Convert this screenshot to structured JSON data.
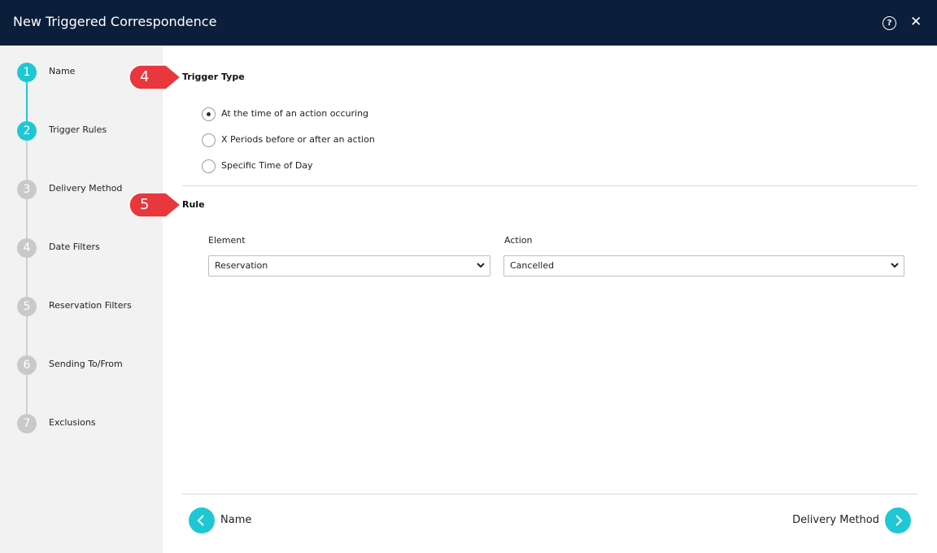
{
  "window": {
    "title": "New Triggered Correspondence",
    "help_icon": "question-circle-icon",
    "close_icon": "close-icon"
  },
  "steps": [
    {
      "num": "1",
      "label": "Name",
      "state": "done"
    },
    {
      "num": "2",
      "label": "Trigger Rules",
      "state": "active"
    },
    {
      "num": "3",
      "label": "Delivery Method",
      "state": "pending"
    },
    {
      "num": "4",
      "label": "Date Filters",
      "state": "pending"
    },
    {
      "num": "5",
      "label": "Reservation Filters",
      "state": "pending"
    },
    {
      "num": "6",
      "label": "Sending To/From",
      "state": "pending"
    },
    {
      "num": "7",
      "label": "Exclusions",
      "state": "pending"
    }
  ],
  "callouts": {
    "trigger": "4",
    "rule": "5"
  },
  "trigger_type": {
    "title": "Trigger Type",
    "options": [
      {
        "label": "At the time of an action occuring",
        "checked": true
      },
      {
        "label": "X Periods before or after an action",
        "checked": false
      },
      {
        "label": "Specific Time of Day",
        "checked": false
      }
    ]
  },
  "rule": {
    "title": "Rule",
    "element_label": "Element",
    "element_value": "Reservation",
    "action_label": "Action",
    "action_value": "Cancelled"
  },
  "footer": {
    "back_label": "Name",
    "next_label": "Delivery Method"
  },
  "colors": {
    "header": "#0b1e3a",
    "accent": "#1fc7d4",
    "callout": "#e8373d"
  }
}
